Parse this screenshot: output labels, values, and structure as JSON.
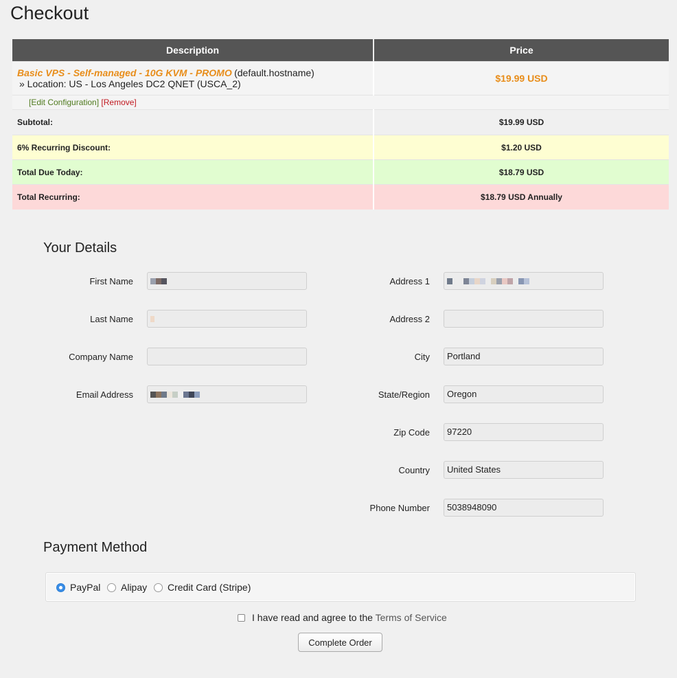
{
  "page": {
    "title": "Checkout"
  },
  "cart": {
    "headers": {
      "description": "Description",
      "price": "Price"
    },
    "item": {
      "name": "Basic VPS - Self-managed - 10G KVM - PROMO",
      "hostname": "(default.hostname)",
      "location": "» Location: US - Los Angeles DC2 QNET (USCA_2)",
      "price": "$19.99 USD",
      "edit_label": "[Edit Configuration]",
      "remove_label": "[Remove]"
    },
    "subtotal": {
      "label": "Subtotal:",
      "value": "$19.99 USD"
    },
    "discount": {
      "label": "6% Recurring Discount:",
      "value": "$1.20 USD"
    },
    "total_due": {
      "label": "Total Due Today:",
      "value": "$18.79 USD"
    },
    "total_recurring": {
      "label": "Total Recurring:",
      "value": "$18.79 USD Annually"
    }
  },
  "details": {
    "heading": "Your Details",
    "first_name": {
      "label": "First Name",
      "value": ""
    },
    "last_name": {
      "label": "Last Name",
      "value": ""
    },
    "company": {
      "label": "Company Name",
      "value": ""
    },
    "email": {
      "label": "Email Address",
      "value": ""
    },
    "address1": {
      "label": "Address 1",
      "value": ""
    },
    "address2": {
      "label": "Address 2",
      "value": ""
    },
    "city": {
      "label": "City",
      "value": "Portland"
    },
    "state": {
      "label": "State/Region",
      "value": "Oregon"
    },
    "zip": {
      "label": "Zip Code",
      "value": "97220"
    },
    "country": {
      "label": "Country",
      "value": "United States"
    },
    "phone": {
      "label": "Phone Number",
      "value": "5038948090"
    }
  },
  "payment": {
    "heading": "Payment Method",
    "options": [
      "PayPal",
      "Alipay",
      "Credit Card (Stripe)"
    ],
    "selected": "PayPal"
  },
  "tos": {
    "text": "I have read and agree to the",
    "link": "Terms of Service"
  },
  "order_button": "Complete Order",
  "colors": {
    "accent_orange": "#e88d1a",
    "header_bg": "#555555",
    "discount_bg": "#fefed2",
    "due_bg": "#e1fdd0",
    "recurring_bg": "#fdd9d9"
  }
}
